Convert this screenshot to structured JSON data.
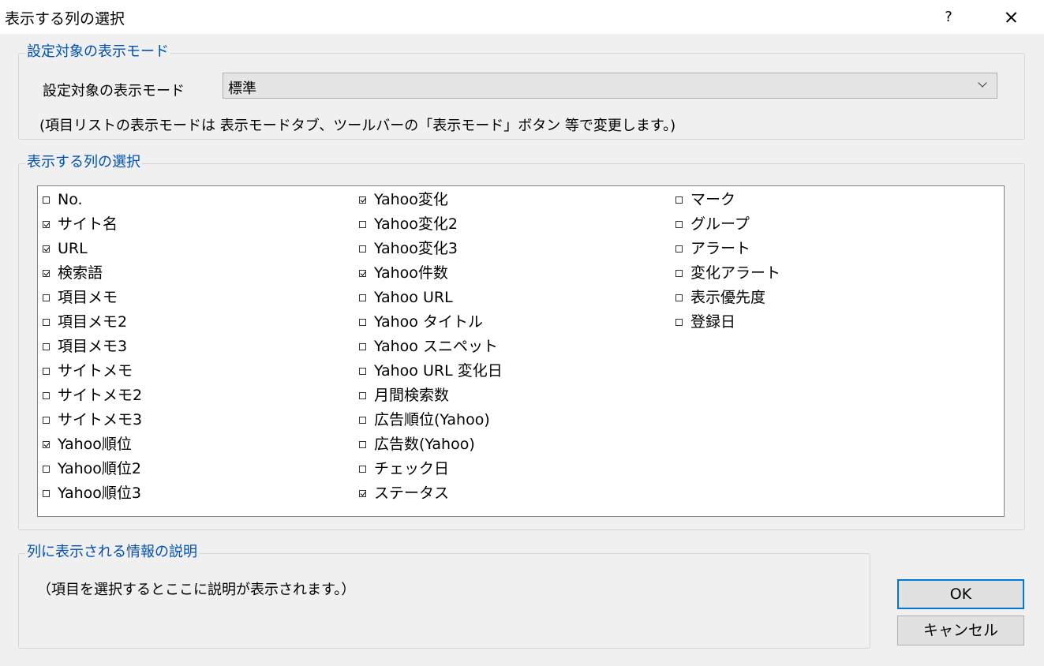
{
  "window": {
    "title": "表示する列の選択",
    "help": "?",
    "close": "×"
  },
  "mode_group": {
    "legend": "設定対象の表示モード",
    "label": "設定対象の表示モード",
    "selected": "標準",
    "note": "(項目リストの表示モードは 表示モードタブ、ツールバーの「表示モード」ボタン 等で変更します。)"
  },
  "columns_group": {
    "legend": "表示する列の選択",
    "columns": [
      [
        {
          "label": "No.",
          "checked": false
        },
        {
          "label": "サイト名",
          "checked": true
        },
        {
          "label": "URL",
          "checked": true
        },
        {
          "label": "検索語",
          "checked": true
        },
        {
          "label": "項目メモ",
          "checked": false
        },
        {
          "label": "項目メモ2",
          "checked": false
        },
        {
          "label": "項目メモ3",
          "checked": false
        },
        {
          "label": "サイトメモ",
          "checked": false
        },
        {
          "label": "サイトメモ2",
          "checked": false
        },
        {
          "label": "サイトメモ3",
          "checked": false
        },
        {
          "label": "Yahoo順位",
          "checked": true
        },
        {
          "label": "Yahoo順位2",
          "checked": false
        },
        {
          "label": "Yahoo順位3",
          "checked": false
        }
      ],
      [
        {
          "label": "Yahoo変化",
          "checked": true
        },
        {
          "label": "Yahoo変化2",
          "checked": false
        },
        {
          "label": "Yahoo変化3",
          "checked": false
        },
        {
          "label": "Yahoo件数",
          "checked": true
        },
        {
          "label": "Yahoo URL",
          "checked": false
        },
        {
          "label": "Yahoo タイトル",
          "checked": false
        },
        {
          "label": "Yahoo スニペット",
          "checked": false
        },
        {
          "label": "Yahoo URL 変化日",
          "checked": false
        },
        {
          "label": "月間検索数",
          "checked": false
        },
        {
          "label": "広告順位(Yahoo)",
          "checked": false
        },
        {
          "label": "広告数(Yahoo)",
          "checked": false
        },
        {
          "label": "チェック日",
          "checked": false
        },
        {
          "label": "ステータス",
          "checked": true
        }
      ],
      [
        {
          "label": "マーク",
          "checked": false
        },
        {
          "label": "グループ",
          "checked": false
        },
        {
          "label": "アラート",
          "checked": false
        },
        {
          "label": "変化アラート",
          "checked": false
        },
        {
          "label": "表示優先度",
          "checked": false
        },
        {
          "label": "登録日",
          "checked": false
        }
      ]
    ]
  },
  "desc_group": {
    "legend": "列に表示される情報の説明",
    "text": "（項目を選択するとここに説明が表示されます。）"
  },
  "buttons": {
    "ok": "OK",
    "cancel": "キャンセル"
  },
  "colors": {
    "accent": "#0078d7",
    "legend": "#0050b8"
  }
}
